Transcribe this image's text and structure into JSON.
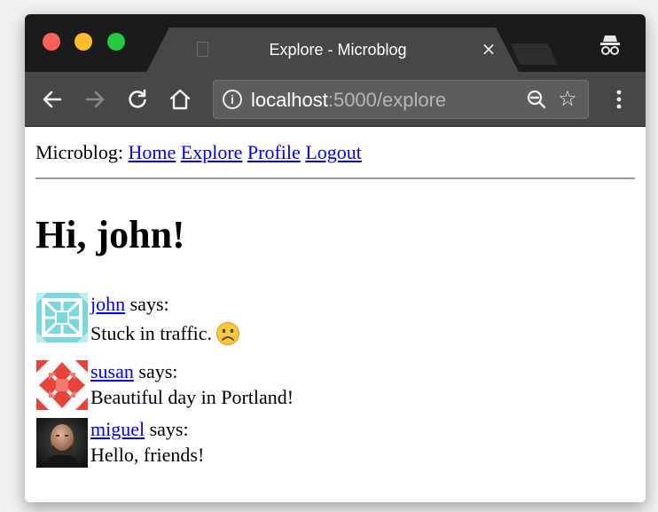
{
  "window": {
    "tab_title": "Explore - Microblog",
    "close_glyph": "×",
    "star_glyph": "☆",
    "info_glyph": "i"
  },
  "toolbar": {
    "url_host": "localhost",
    "url_path": ":5000/explore"
  },
  "nav": {
    "brand": "Microblog:",
    "links": [
      "Home",
      "Explore",
      "Profile",
      "Logout"
    ]
  },
  "greeting": "Hi, john!",
  "posts": [
    {
      "author": "john",
      "says": "says:",
      "body": "Stuck in traffic.",
      "avatar": "teal-identicon",
      "emoji": "frowning-face-icon"
    },
    {
      "author": "susan",
      "says": "says:",
      "body": "Beautiful day in Portland!",
      "avatar": "red-identicon"
    },
    {
      "author": "miguel",
      "says": "says:",
      "body": "Hello, friends!",
      "avatar": "photo-avatar"
    }
  ],
  "colors": {
    "link": "#0000ee",
    "tab_bar": "#1b1b1d",
    "toolbar": "#474747",
    "close_red": "#fc5f57",
    "minimize_yellow": "#fdbb2e",
    "zoom_green": "#27c83f"
  }
}
